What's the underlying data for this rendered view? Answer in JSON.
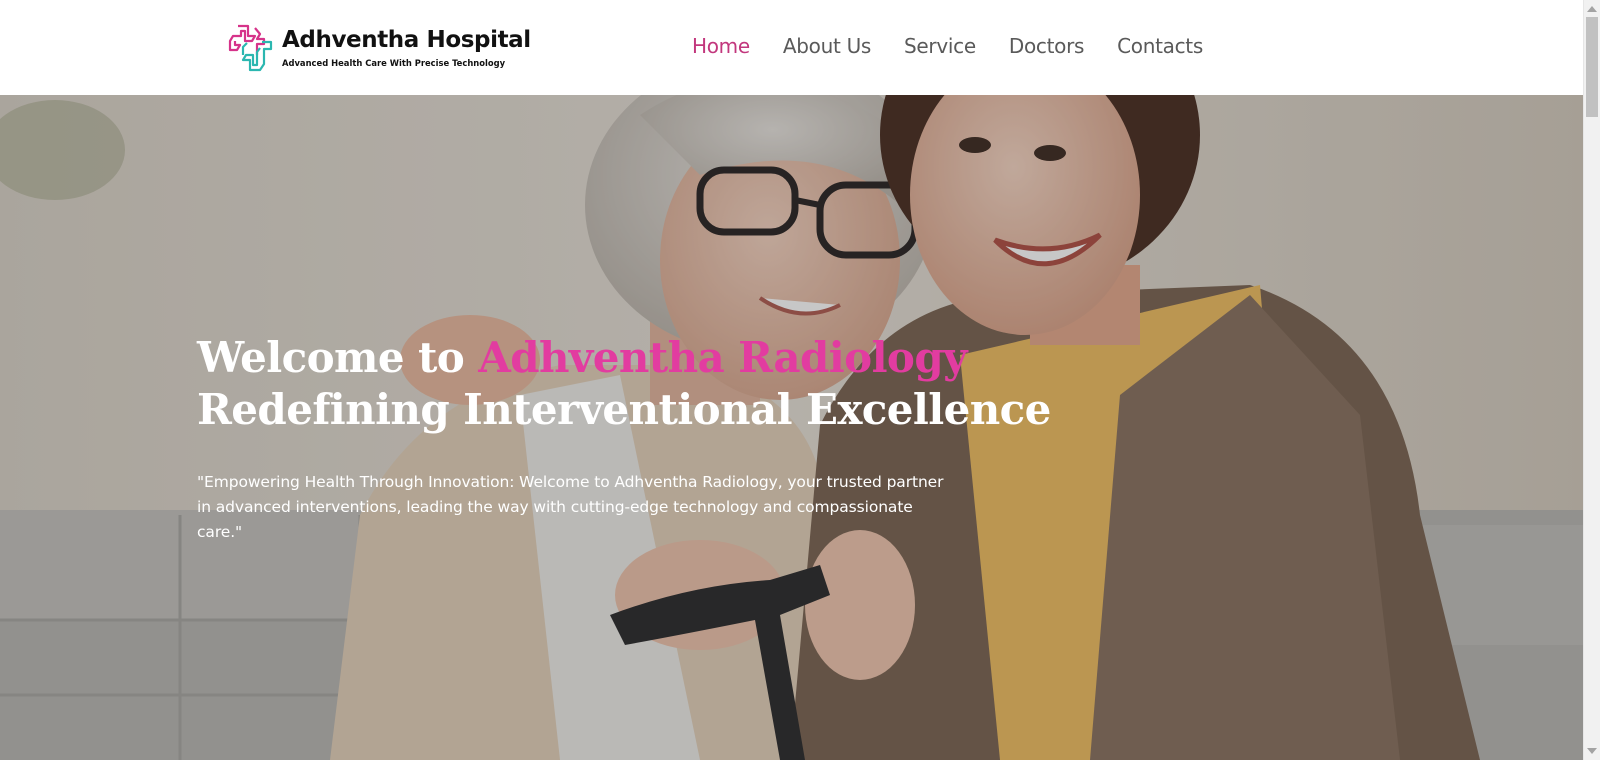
{
  "brand": {
    "name": "Adhventha Hospital",
    "tagline": "Advanced Health Care With Precise Technology",
    "logo_icon": "medical-cross-logo-icon"
  },
  "nav": {
    "items": [
      {
        "label": "Home",
        "active": true
      },
      {
        "label": "About Us",
        "active": false
      },
      {
        "label": "Service",
        "active": false
      },
      {
        "label": "Doctors",
        "active": false
      },
      {
        "label": "Contacts",
        "active": false
      }
    ]
  },
  "hero": {
    "heading_prefix": "Welcome to ",
    "heading_accent": "Adhventha Radiology",
    "heading_line2": "Redefining Interventional Excellence",
    "quote": "\"Empowering Health Through Innovation: Welcome to Adhventha Radiology, your trusted partner in advanced interventions, leading the way with cutting-edge technology and compassionate care.\""
  },
  "colors": {
    "accent_nav": "#c2377d",
    "accent_heading": "#e23ca0",
    "logo_pink": "#d6338a",
    "logo_teal": "#2bb7b0",
    "nav_text": "#5a5a5a"
  }
}
